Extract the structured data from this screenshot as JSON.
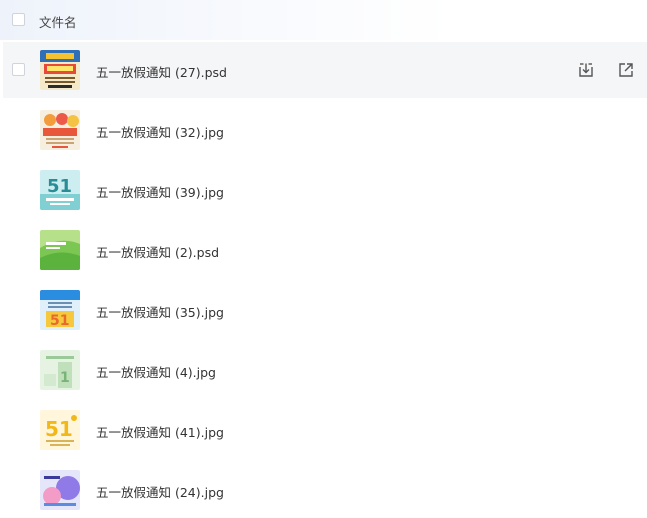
{
  "header": {
    "column_label": "文件名"
  },
  "files": [
    {
      "name": "五一放假通知 (27).psd",
      "selected": true,
      "thumb": "thumb-27"
    },
    {
      "name": "五一放假通知 (32).jpg",
      "selected": false,
      "thumb": "thumb-32"
    },
    {
      "name": "五一放假通知 (39).jpg",
      "selected": false,
      "thumb": "thumb-39"
    },
    {
      "name": "五一放假通知 (2).psd",
      "selected": false,
      "thumb": "thumb-2"
    },
    {
      "name": "五一放假通知 (35).jpg",
      "selected": false,
      "thumb": "thumb-35"
    },
    {
      "name": "五一放假通知 (4).jpg",
      "selected": false,
      "thumb": "thumb-4"
    },
    {
      "name": "五一放假通知 (41).jpg",
      "selected": false,
      "thumb": "thumb-41"
    },
    {
      "name": "五一放假通知 (24).jpg",
      "selected": false,
      "thumb": "thumb-24"
    }
  ],
  "row_actions": [
    {
      "icon": "download-icon"
    },
    {
      "icon": "open-external-icon"
    }
  ],
  "colors": {
    "selected_row_bg": "#f5f6f8",
    "header_bg": "#eef3fb",
    "icon": "#555555"
  }
}
